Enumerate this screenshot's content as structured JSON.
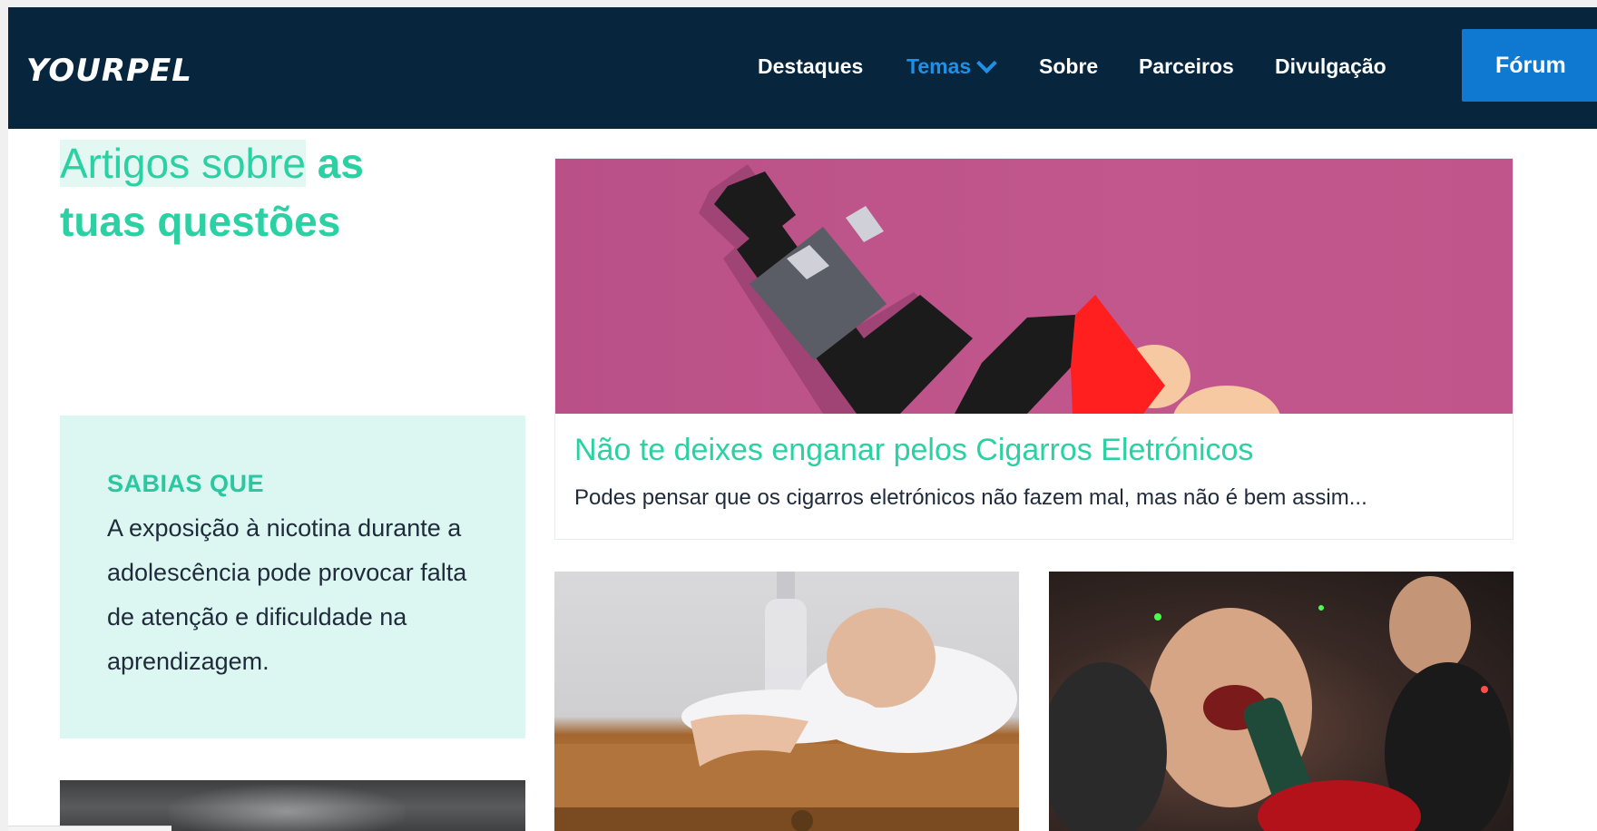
{
  "brand": {
    "logo": "YOURPEL"
  },
  "nav": {
    "items": [
      "Destaques",
      "Temas",
      "Sobre",
      "Parceiros",
      "Divulgação"
    ],
    "active": "Temas",
    "forum_button": "Fórum"
  },
  "intro": {
    "highlight": "Artigos sobre",
    "rest_line1": "as",
    "line2": "tuas questões"
  },
  "fact": {
    "title": "SABIAS QUE",
    "text": "A exposição à nicotina durante a adolescência pode provocar falta de atenção e dificuldade na aprendizagem."
  },
  "featured_article": {
    "title": "Não te deixes enganar pelos Cigarros Eletrónicos",
    "excerpt": "Podes pensar que os cigarros eletrónicos não fazem mal, mas não é bem assim..."
  },
  "colors": {
    "nav_bg": "#07253d",
    "accent_teal": "#2bd1a3",
    "accent_blue": "#1e90e6",
    "forum_bg": "#0f78d1",
    "fact_bg": "#dcf7f1",
    "feature_img_bg": "#c1578c"
  }
}
